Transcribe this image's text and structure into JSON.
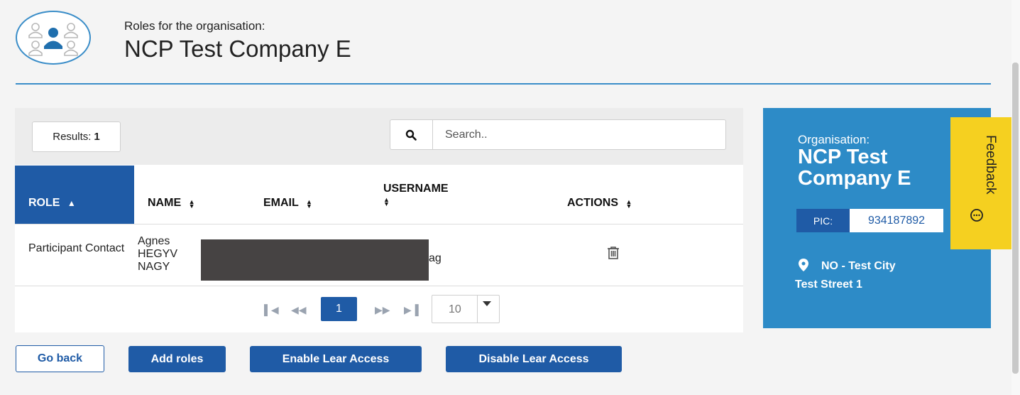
{
  "header": {
    "subtitle": "Roles for the organisation:",
    "title": "NCP Test Company E",
    "logo_icon": "people-group-icon"
  },
  "toolbar": {
    "results_label": "Results:",
    "results_count": "1",
    "search_placeholder": "Search..",
    "search_icon": "search-icon"
  },
  "table": {
    "columns": [
      {
        "label": "ROLE",
        "sort": "asc"
      },
      {
        "label": "NAME",
        "sort": "both"
      },
      {
        "label": "EMAIL",
        "sort": "both"
      },
      {
        "label": "USERNAME",
        "sort": "both"
      },
      {
        "label": "ACTIONS",
        "sort": "both"
      }
    ],
    "rows": [
      {
        "role": "Participant Contact",
        "name": "Agnes HEGYV NAGY",
        "email": "",
        "username": "ag",
        "actions": [
          "trash-icon"
        ]
      }
    ]
  },
  "pagination": {
    "current_page": "1",
    "page_size": "10"
  },
  "buttons": {
    "back": "Go back",
    "add_roles": "Add roles",
    "enable_lear": "Enable Lear Access",
    "disable_lear": "Disable Lear Access"
  },
  "organisation": {
    "label": "Organisation:",
    "name": "NCP Test Company E",
    "pic_label": "PIC:",
    "pic_value": "934187892",
    "location_icon": "map-marker-icon",
    "location": "NO - Test City",
    "street": "Test Street 1"
  },
  "feedback": {
    "label": "Feedback",
    "icon": "feedback-bubble-icon"
  },
  "colors": {
    "primary": "#1f5ba6",
    "card": "#2d8bc7",
    "feedback": "#f5d020",
    "accent_line": "#3a8dc8"
  }
}
